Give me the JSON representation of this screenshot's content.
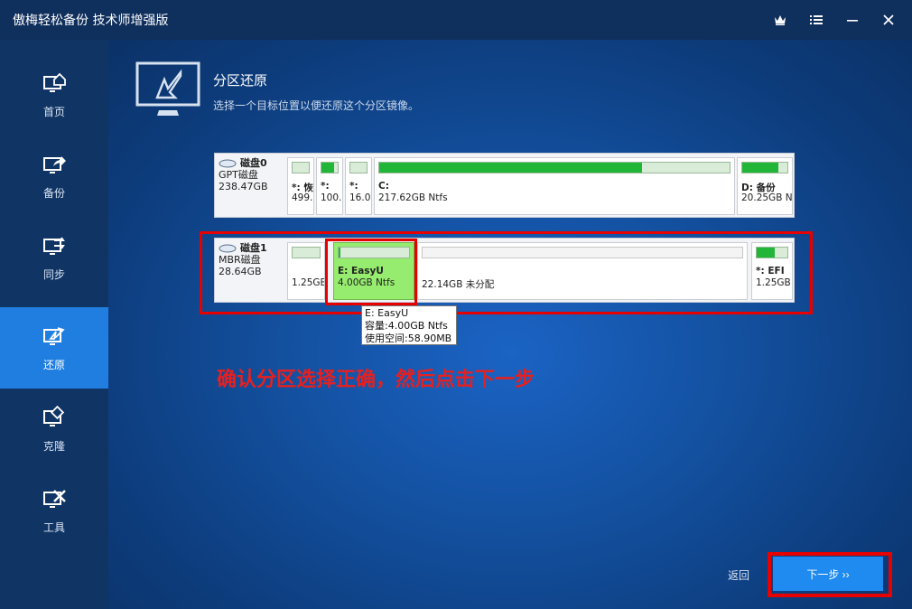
{
  "window": {
    "title": "傲梅轻松备份 技术师增强版"
  },
  "sidebar": {
    "items": [
      {
        "label": "首页",
        "icon": "home-icon",
        "active": false
      },
      {
        "label": "备份",
        "icon": "backup-icon",
        "active": false
      },
      {
        "label": "同步",
        "icon": "sync-icon",
        "active": false
      },
      {
        "label": "还原",
        "icon": "restore-icon",
        "active": true
      },
      {
        "label": "克隆",
        "icon": "clone-icon",
        "active": false
      },
      {
        "label": "工具",
        "icon": "tools-icon",
        "active": false
      }
    ]
  },
  "page": {
    "title": "分区还原",
    "subtitle": "选择一个目标位置以便还原这个分区镜像。"
  },
  "disks": [
    {
      "name": "磁盘0",
      "type": "GPT磁盘",
      "size": "238.47GB",
      "partitions": [
        {
          "label": "*: 恢",
          "info": "499.",
          "used_fraction": 0.0
        },
        {
          "label": "*:",
          "info": "100.",
          "used_fraction": 0.75
        },
        {
          "label": "*:",
          "info": "16.0",
          "used_fraction": 0.0
        },
        {
          "label": "C:",
          "info": "217.62GB Ntfs",
          "used_fraction": 0.75
        },
        {
          "label": "D: 备份",
          "info": "20.25GB Nt",
          "used_fraction": 0.8
        }
      ]
    },
    {
      "name": "磁盘1",
      "type": "MBR磁盘",
      "size": "28.64GB",
      "partitions": [
        {
          "label": "",
          "info": "1.25GB",
          "used_fraction": 0.0
        },
        {
          "label": "E: EasyU",
          "info": "4.00GB Ntfs",
          "used_fraction": 0.02,
          "selected": true
        },
        {
          "label": "",
          "info": "22.14GB 未分配",
          "used_fraction": 0.0,
          "unallocated": true
        },
        {
          "label": "*: EFI",
          "info": "1.25GB I",
          "used_fraction": 0.6
        }
      ]
    }
  ],
  "tooltip": {
    "title": "E: EasyU",
    "capacity": "容量:4.00GB Ntfs",
    "used": "使用空间:58.90MB"
  },
  "instruction": "确认分区选择正确，然后点击下一步",
  "footer": {
    "back_label": "返回",
    "next_label": "下一步 ››"
  },
  "colors": {
    "accent": "#1f8af0",
    "selected_partition": "#96ec6e",
    "used_fill": "#22b638",
    "highlight_red": "#e60000"
  }
}
